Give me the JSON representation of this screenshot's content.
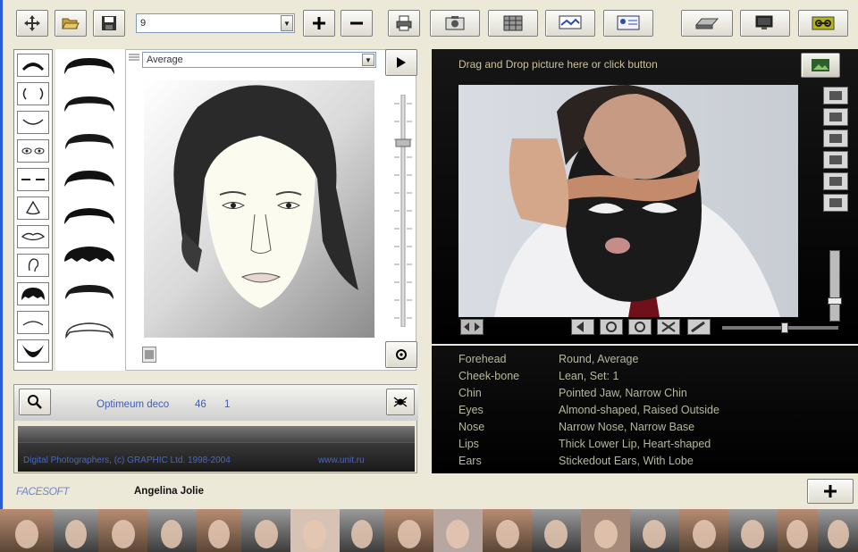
{
  "toolbar": {
    "combo_value": "9",
    "icons": [
      "move-icon",
      "open-folder-icon",
      "save-icon",
      "plus-icon",
      "minus-icon",
      "print-icon",
      "photo-icon",
      "grid-icon",
      "web-icon",
      "id-card-icon",
      "scanner-icon",
      "monitor-icon",
      "link-icon"
    ]
  },
  "sketch": {
    "preset_value": "Average"
  },
  "features": [
    "eyebrows",
    "eyes",
    "mouth",
    "eyes-pair",
    "brows-line",
    "nose",
    "lips",
    "ear",
    "hair",
    "chin-line",
    "beard"
  ],
  "search": {
    "label": "Optimeum deco",
    "count": "46",
    "page": "1"
  },
  "footer": {
    "copyright": "Digital Photographers, (c) GRAPHIC Ltd. 1998-2004",
    "url": "www.unit.ru"
  },
  "photo_panel": {
    "instruction": "Drag and Drop picture here or click button"
  },
  "traits": [
    {
      "key": "Forehead",
      "value": "Round, Average"
    },
    {
      "key": "Cheek-bone",
      "value": "Lean, Set: 1"
    },
    {
      "key": "Chin",
      "value": "Pointed Jaw, Narrow Chin"
    },
    {
      "key": "Eyes",
      "value": "Almond-shaped, Raised Outside"
    },
    {
      "key": "Nose",
      "value": "Narrow Nose, Narrow Base"
    },
    {
      "key": "Lips",
      "value": "Thick Lower Lip, Heart-shaped"
    },
    {
      "key": "Ears",
      "value": "Stickedout Ears, With Lobe"
    }
  ],
  "gallery": {
    "logo": "FACESOFT",
    "selected_name": "Angelina Jolie"
  }
}
